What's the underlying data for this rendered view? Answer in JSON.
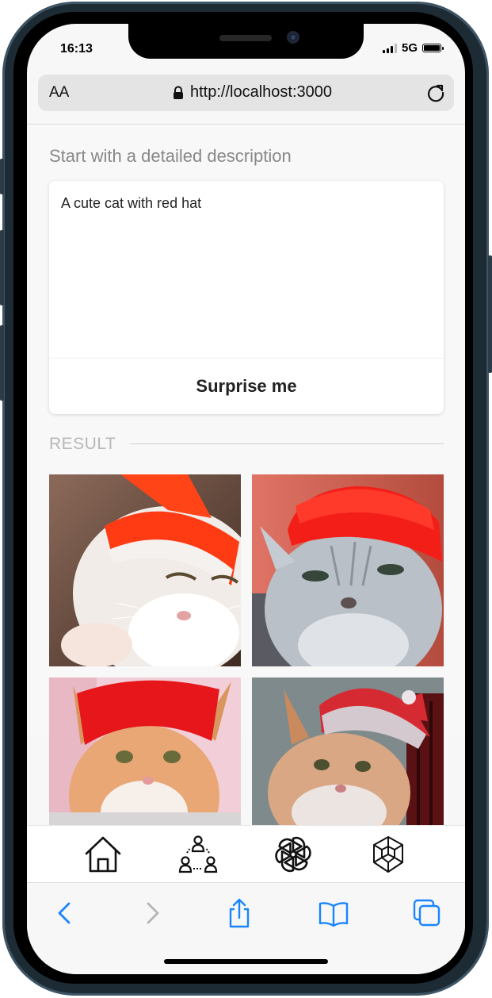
{
  "status": {
    "time": "16:13",
    "network": "5G"
  },
  "browser": {
    "aa_label": "AA",
    "url": "http://localhost:3000"
  },
  "prompt": {
    "label": "Start with a detailed description",
    "text": "A cute cat with red hat",
    "surprise_label": "Surprise me"
  },
  "result": {
    "label": "RESULT"
  },
  "results": [
    {
      "alt": "white cat wearing red and white hat"
    },
    {
      "alt": "grey tabby cat wearing red hat"
    },
    {
      "alt": "orange and white cat wearing red beanie"
    },
    {
      "alt": "orange cat wearing santa hat"
    }
  ],
  "tabs": [
    {
      "name": "home-tab",
      "icon": "home-icon"
    },
    {
      "name": "community-tab",
      "icon": "community-icon"
    },
    {
      "name": "openai-tab",
      "icon": "openai-icon"
    },
    {
      "name": "blocks-tab",
      "icon": "cube-icon"
    }
  ],
  "colors": {
    "accent": "#1a84ff",
    "hat_red": "#e8221b"
  }
}
